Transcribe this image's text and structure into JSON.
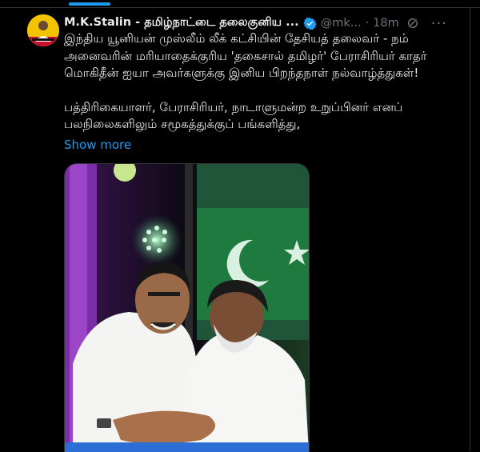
{
  "post": {
    "author_name": "M.K.Stalin - தமிழ்நாட்டை தலைகுனிய ...",
    "handle": "@mk...",
    "separator": "·",
    "time": "18m",
    "text_paragraph_1": "இந்திய யூனியன் முஸ்லீம் லீக் கட்சியின் தேசியத் தலைவர் - நம் அனைவரின் மரியாதைக்குரிய 'தகைசால் தமிழர்' பேராசிரியர் காதர் மொகிதீன் ஐயா அவர்களுக்கு இனிய பிறந்தநாள் நல்வாழ்த்துகள்!",
    "text_paragraph_2": "பத்திரிகையாளர், பேராசிரியர், நாடாளுமன்ற உறுப்பினர் எனப் பலநிலைகளிலும் சமூகத்துக்குப் பங்களித்து,",
    "show_more": "Show more"
  },
  "icons": {
    "verified": "verified-badge-icon",
    "grok": "grok-icon",
    "more": "more-options-icon"
  },
  "colors": {
    "background": "#000000",
    "text": "#e7e9ea",
    "muted": "#71767b",
    "accent": "#1d9bf0",
    "border": "#2f3336"
  }
}
